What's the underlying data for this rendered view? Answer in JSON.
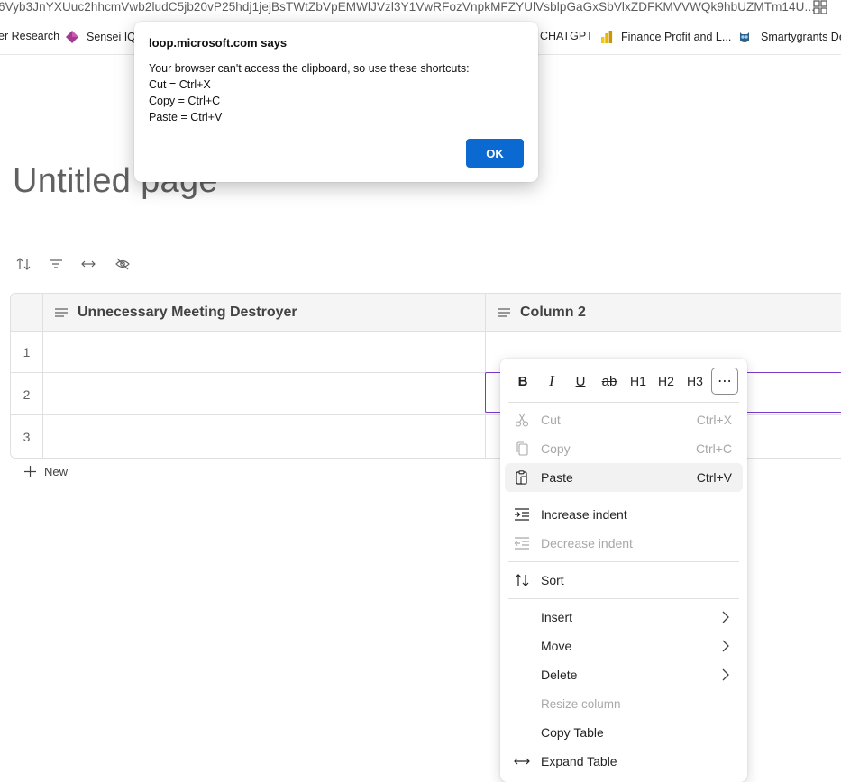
{
  "browser": {
    "url": "6Vyb3JnYXUuc2hhcmVwb2ludC5jb20vP25hdj1jejBsTWtZbVpEMWlJVzl3Y1VwRFozVnpkMFZYUlVsblpGaGxSbVlxZDFKMVVWQk9hbUZMTm14U...",
    "bookmarks": [
      {
        "label": "er Research"
      },
      {
        "label": "Sensei IQ"
      },
      {
        "label": "CHATGPT"
      },
      {
        "label": "Finance Profit and L..."
      },
      {
        "label": "Smartygrants Dep"
      }
    ]
  },
  "dialog": {
    "title": "loop.microsoft.com says",
    "lines": [
      "Your browser can't access the clipboard, so use these shortcuts:",
      "Cut = Ctrl+X",
      "Copy = Ctrl+C",
      "Paste = Ctrl+V"
    ],
    "ok_label": "OK"
  },
  "page": {
    "title": "Untitled page"
  },
  "table": {
    "columns": [
      "Unnecessary Meeting Destroyer",
      "Column 2"
    ],
    "rows": [
      "1",
      "2",
      "3"
    ],
    "new_label": "New"
  },
  "context_menu": {
    "format_buttons": [
      "B",
      "I",
      "U",
      "ab",
      "H1",
      "H2",
      "H3",
      "⋯"
    ],
    "items": [
      {
        "label": "Cut",
        "shortcut": "Ctrl+X",
        "disabled": true
      },
      {
        "label": "Copy",
        "shortcut": "Ctrl+C",
        "disabled": true
      },
      {
        "label": "Paste",
        "shortcut": "Ctrl+V",
        "disabled": false
      },
      {
        "label": "Increase indent",
        "disabled": false
      },
      {
        "label": "Decrease indent",
        "disabled": true
      },
      {
        "label": "Sort",
        "disabled": false
      },
      {
        "label": "Insert",
        "submenu": true
      },
      {
        "label": "Move",
        "submenu": true
      },
      {
        "label": "Delete",
        "submenu": true
      },
      {
        "label": "Resize column",
        "disabled": true
      },
      {
        "label": "Copy Table",
        "disabled": false
      },
      {
        "label": "Expand Table",
        "disabled": false
      }
    ]
  },
  "colors": {
    "accent_purple": "#7a39c9",
    "ok_blue": "#0a6ad1"
  }
}
